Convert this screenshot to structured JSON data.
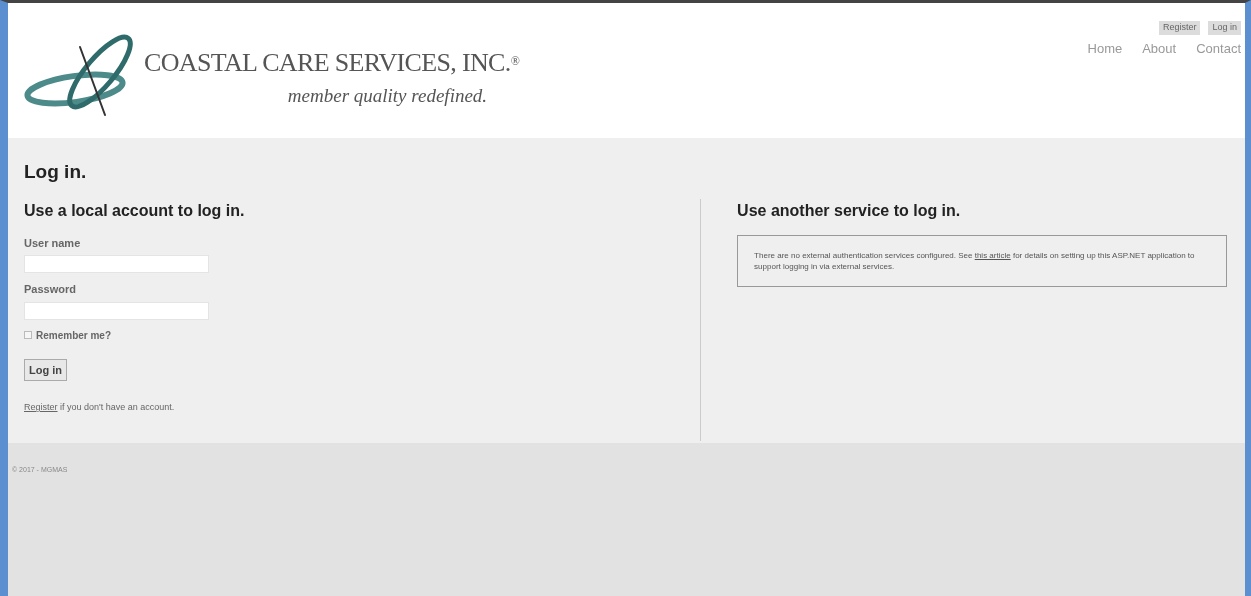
{
  "header": {
    "logo": {
      "name": "COASTAL CARE SERVICES, INC.",
      "mark": "®",
      "tagline": "member quality redefined."
    },
    "account_links": [
      "Register",
      "Log in"
    ],
    "nav": [
      "Home",
      "About",
      "Contact"
    ]
  },
  "title": "Log in.",
  "local": {
    "heading": "Use a local account to log in.",
    "fields": [
      {
        "label": "User name"
      },
      {
        "label": "Password"
      }
    ],
    "remember": {
      "label": "Remember me?",
      "checked": false
    },
    "submit": "Log in",
    "register_link": "Register",
    "register_text": " if you don't have an account."
  },
  "external": {
    "heading": "Use another service to log in.",
    "text_before": "There are no external authentication services configured. See ",
    "link": "this article",
    "text_after": " for details on setting up this ASP.NET application to support logging in via external services."
  },
  "footer": "© 2017 - MGMAS"
}
